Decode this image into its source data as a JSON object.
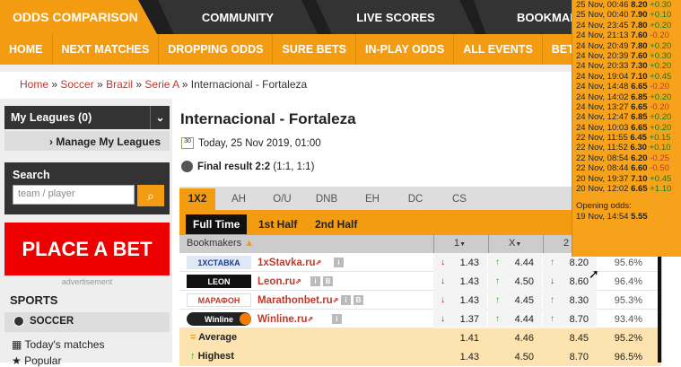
{
  "top_tabs": {
    "odds_comparison": "ODDS COMPARISON",
    "community": "COMMUNITY",
    "live_scores": "LIVE SCORES",
    "bookmakers": "BOOKMAKE"
  },
  "nav": [
    "HOME",
    "NEXT MATCHES",
    "DROPPING ODDS",
    "SURE BETS",
    "IN-PLAY ODDS",
    "ALL EVENTS",
    "BETTIN"
  ],
  "breadcrumb": [
    "Home",
    "Soccer",
    "Brazil",
    "Serie A",
    "Internacional - Fortaleza"
  ],
  "sidebar": {
    "my_leagues": "My Leagues (0)",
    "manage": "Manage My Leagues",
    "search_title": "Search",
    "search_placeholder": "team / player",
    "place_bet": "PLACE A BET",
    "advert": "advertisement",
    "sports": "SPORTS",
    "soccer": "SOCCER",
    "todays": "Today's matches",
    "popular": "Popular"
  },
  "match": {
    "title": "Internacional - Fortaleza",
    "date": "Today, 25 Nov 2019, 01:00",
    "result_label": "Final result 2:2",
    "result_halves": "(1:1, 1:1)"
  },
  "market_tabs": [
    "1X2",
    "AH",
    "O/U",
    "DNB",
    "EH",
    "DC",
    "CS"
  ],
  "phase_tabs": [
    "Full Time",
    "1st Half",
    "2nd Half"
  ],
  "table_header": {
    "bookmakers": "Bookmakers",
    "c1": "1",
    "cx": "X",
    "c2": "2"
  },
  "rows": [
    {
      "logo": "1XСТАВКА",
      "name": "1xStavka.ru",
      "o1": "1.43",
      "ox": "4.44",
      "o2": "8.20",
      "payout": "95.6%"
    },
    {
      "logo": "LEON",
      "name": "Leon.ru",
      "o1": "1.43",
      "ox": "4.50",
      "o2": "8.60",
      "payout": "96.4%"
    },
    {
      "logo": "МАРАФОН",
      "name": "Marathonbet.ru",
      "o1": "1.43",
      "ox": "4.45",
      "o2": "8.30",
      "payout": "95.3%"
    },
    {
      "logo": "Winline",
      "name": "Winline.ru",
      "o1": "1.37",
      "ox": "4.44",
      "o2": "8.70",
      "payout": "93.4%"
    }
  ],
  "average": {
    "label": "Average",
    "o1": "1.41",
    "ox": "4.46",
    "o2": "8.45",
    "payout": "95.2%"
  },
  "highest": {
    "label": "Highest",
    "o1": "1.43",
    "ox": "4.50",
    "o2": "8.70",
    "payout": "96.5%"
  },
  "history": [
    {
      "t": "25 Nov, 00:46",
      "v": "8.20",
      "c": "+0.30"
    },
    {
      "t": "25 Nov, 00:40",
      "v": "7.90",
      "c": "+0.10"
    },
    {
      "t": "24 Nov, 23:45",
      "v": "7.80",
      "c": "+0.20"
    },
    {
      "t": "24 Nov, 21:13",
      "v": "7.60",
      "c": "-0.20"
    },
    {
      "t": "24 Nov, 20:49",
      "v": "7.80",
      "c": "+0.20"
    },
    {
      "t": "24 Nov, 20:39",
      "v": "7.60",
      "c": "+0.30"
    },
    {
      "t": "24 Nov, 20:33",
      "v": "7.30",
      "c": "+0.20"
    },
    {
      "t": "24 Nov, 19:04",
      "v": "7.10",
      "c": "+0.45"
    },
    {
      "t": "24 Nov, 14:48",
      "v": "6.65",
      "c": "-0.20"
    },
    {
      "t": "24 Nov, 14:02",
      "v": "6.85",
      "c": "+0.20"
    },
    {
      "t": "24 Nov, 13:27",
      "v": "6.65",
      "c": "-0.20"
    },
    {
      "t": "24 Nov, 12:47",
      "v": "6.85",
      "c": "+0.20"
    },
    {
      "t": "24 Nov, 10:03",
      "v": "6.65",
      "c": "+0.20"
    },
    {
      "t": "22 Nov, 11:55",
      "v": "6.45",
      "c": "+0.15"
    },
    {
      "t": "22 Nov, 11:52",
      "v": "6.30",
      "c": "+0.10"
    },
    {
      "t": "22 Nov, 08:54",
      "v": "6.20",
      "c": "-0.25"
    },
    {
      "t": "22 Nov, 08:44",
      "v": "6.60",
      "c": "-0.50"
    },
    {
      "t": "20 Nov, 19:37",
      "v": "7.10",
      "c": "+0.45"
    },
    {
      "t": "20 Nov, 12:02",
      "v": "6.65",
      "c": "+1.10"
    }
  ],
  "opening": {
    "label": "Opening odds:",
    "t": "19 Nov, 14:54",
    "v": "5.55"
  }
}
